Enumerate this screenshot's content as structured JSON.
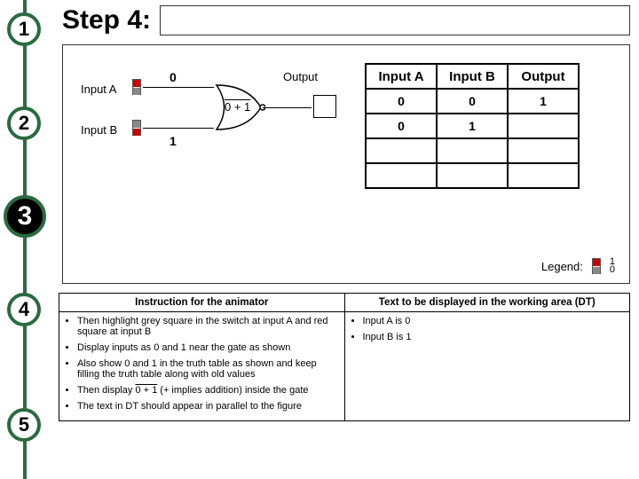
{
  "steps": [
    "1",
    "2",
    "3",
    "4",
    "5"
  ],
  "active_step_index": 2,
  "title": "Step 4:",
  "circuit": {
    "inputA_label": "Input A",
    "inputB_label": "Input B",
    "inputA_value": "0",
    "inputB_value": "1",
    "gate_expression": "0 + 1",
    "output_label": "Output"
  },
  "truth_table": {
    "headers": [
      "Input A",
      "Input B",
      "Output"
    ],
    "rows": [
      [
        "0",
        "0",
        "1"
      ],
      [
        "0",
        "1",
        ""
      ],
      [
        "",
        "",
        ""
      ],
      [
        "",
        "",
        ""
      ]
    ]
  },
  "legend": {
    "label": "Legend:",
    "top": "1",
    "bottom": "0"
  },
  "instructions": {
    "left_header": "Instruction for the animator",
    "right_header": "Text to be displayed in the working area (DT)",
    "left_items": [
      "Then highlight grey square in the switch at input A and red square at input B",
      "Display inputs as 0 and 1 near the gate as shown",
      "Also show 0 and 1 in the truth table as shown and keep filling the truth table along with old values",
      "Then display 0 + 1 (+ implies addition) inside the gate",
      "The text in DT should appear in parallel to the figure"
    ],
    "right_items": [
      "Input A is 0",
      "Input B is 1"
    ]
  },
  "chart_data": {
    "type": "table",
    "title": "NOR gate truth table (partial, step 4)",
    "columns": [
      "Input A",
      "Input B",
      "Output"
    ],
    "rows": [
      {
        "Input A": 0,
        "Input B": 0,
        "Output": 1
      },
      {
        "Input A": 0,
        "Input B": 1,
        "Output": null
      },
      {
        "Input A": null,
        "Input B": null,
        "Output": null
      },
      {
        "Input A": null,
        "Input B": null,
        "Output": null
      }
    ],
    "gate": "NOR",
    "current_inputs": {
      "A": 0,
      "B": 1
    },
    "gate_internal_text": "0 + 1 (overlined)"
  }
}
